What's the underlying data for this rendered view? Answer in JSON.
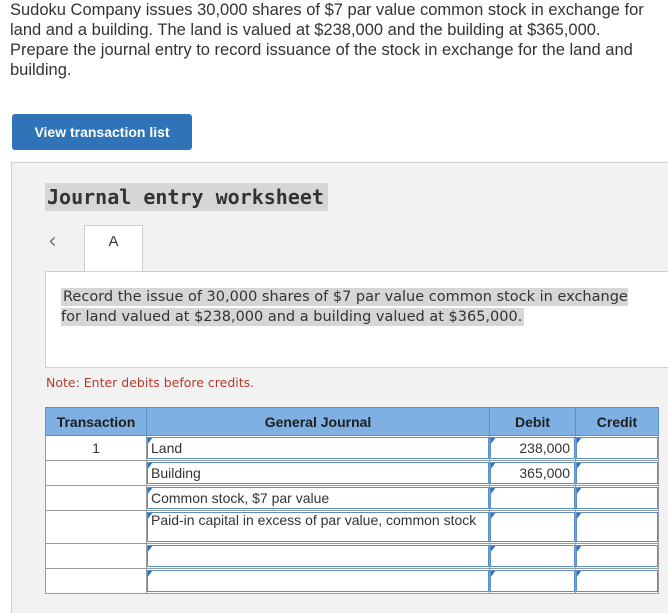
{
  "question": {
    "lines": [
      "Sudoku Company issues 30,000 shares of $7 par value common stock in exchange for",
      "land and a building. The land is valued at $238,000 and the building at $365,000.",
      "Prepare the journal entry to record issuance of the stock in exchange for the land and",
      "building."
    ]
  },
  "view_button": {
    "label": "View transaction list"
  },
  "worksheet": {
    "title": "Journal entry worksheet",
    "prev_icon": "chevron-left-icon",
    "tab_label": "A",
    "instruction": "Record the issue of 30,000 shares of $7 par value common stock in exchange for land valued at $238,000 and a building valued at $365,000.",
    "note": "Note: Enter debits before credits."
  },
  "journal": {
    "headers": {
      "transaction": "Transaction",
      "general_journal": "General Journal",
      "debit": "Debit",
      "credit": "Credit"
    },
    "rows": [
      {
        "transaction": "1",
        "account": "Land",
        "debit": "238,000",
        "credit": ""
      },
      {
        "transaction": "",
        "account": "Building",
        "debit": "365,000",
        "credit": ""
      },
      {
        "transaction": "",
        "account": "Common stock, $7 par value",
        "debit": "",
        "credit": ""
      },
      {
        "transaction": "",
        "account": "Paid-in capital in excess of par value, common stock",
        "debit": "",
        "credit": ""
      },
      {
        "transaction": "",
        "account": "",
        "debit": "",
        "credit": ""
      },
      {
        "transaction": "",
        "account": "",
        "debit": "",
        "credit": ""
      }
    ]
  },
  "colors": {
    "button": "#2f74b8",
    "header": "#7eb0e4",
    "note": "#b33a2e",
    "input_marker": "#2a72c6"
  }
}
